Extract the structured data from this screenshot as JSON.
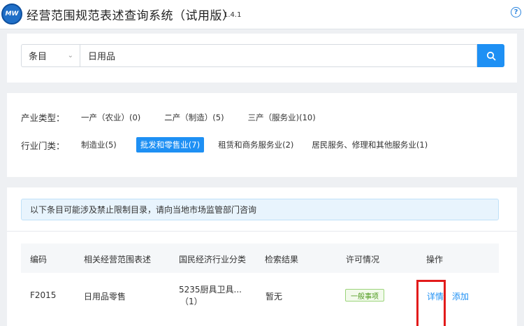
{
  "header": {
    "logo_text": "MW",
    "title": "经营范围规范表述查询系统（试用版）",
    "version": "1.4.1",
    "help_icon": "?"
  },
  "search": {
    "category_selected": "条目",
    "query": "日用品",
    "icon": "search-icon"
  },
  "filters": {
    "industry_type": {
      "label": "产业类型：",
      "options": [
        "一产（农业）(0)",
        "二产（制造）(5)",
        "三产（服务业)(10)"
      ]
    },
    "industry_category": {
      "label": "行业门类：",
      "options": [
        "制造业(5)",
        "批发和零售业(7)",
        "租赁和商务服务业(2)",
        "居民服务、修理和其他服务业(1)"
      ],
      "active_index": 1
    }
  },
  "results": {
    "notice": "以下条目可能涉及禁止限制目录，请向当地市场监管部门咨询",
    "columns": [
      "编码",
      "相关经营范围表述",
      "国民经济行业分类",
      "检索结果",
      "许可情况",
      "操作"
    ],
    "rows": [
      {
        "code": "F2015",
        "description": "日用品零售",
        "industry_line1": "5235厨具卫具...",
        "industry_line2": "（1）",
        "result": "暂无",
        "permit": "一般事项",
        "action_detail": "详情",
        "action_add": "添加"
      }
    ]
  },
  "colors": {
    "accent": "#1e90f4",
    "permit_green": "#4e9a1d",
    "highlight_red": "#e21b1b"
  }
}
